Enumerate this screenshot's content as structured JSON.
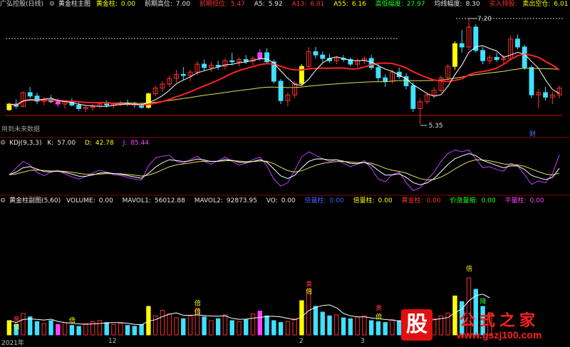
{
  "header_main": {
    "app": "广弘控股(日线)",
    "indicator": "黄金柱主图",
    "gold_col_label": "黄金柱:",
    "gold_col_value": "0.00",
    "prev_high_label": "前期高位:",
    "prev_high_value": "7.00",
    "prev_low_label": "前期低位:",
    "prev_low_value": "5.47",
    "a5_label": "A5:",
    "a5_value": "5.92",
    "a13_label": "A13:",
    "a13_value": "6.01",
    "a55_label": "A55:",
    "a55_value": "6.16",
    "hl_label": "高低幅度:",
    "hl_value": "27.97",
    "avg_label": "均线幅度:",
    "avg_value": "8.30",
    "buy_label": "买入持股:",
    "sell_label": "卖出空仓:",
    "sell_value": "6.01"
  },
  "main_annotations": {
    "high_marker": "7.20",
    "low_marker": "5.35",
    "cai_marker": "财",
    "future_note": "用到未来数据"
  },
  "header_kdj": {
    "name": "KDJ(9,3,3)",
    "k_label": "K:",
    "k_value": "57.00",
    "d_label": "D:",
    "d_value": "42.78",
    "j_label": "J:",
    "j_value": "85.44"
  },
  "header_sub": {
    "name": "黄金柱副图(5,60)",
    "volume_label": "VOLUME:",
    "volume_value": "0.00",
    "mavol1_label": "MAVOL1:",
    "mavol1_value": "56012.88",
    "mavol2_label": "MAVOL2:",
    "mavol2_value": "92873.95",
    "vo_label": "VO:",
    "vo_value": "0.00",
    "dibeizhu_label": "倍量柱:",
    "dibeizhu_value": "0.00",
    "beizhu_label": "倍量柱:",
    "beizhu_value": "0.00",
    "huangjin_label": "黄金柱:",
    "huangjin_value": "0.00",
    "jiasuo_label": "价涨量缩:",
    "jiasuo_value": "0.00",
    "pingliang_label": "平量柱:",
    "pingliang_value": "0.00"
  },
  "sub_annotations": {
    "bei": "倍",
    "huang": "黄",
    "jiang": "降",
    "ping": "平"
  },
  "x_axis": {
    "labels": [
      "2021年",
      "12",
      "2",
      "3"
    ]
  },
  "watermark": {
    "glyph": "股",
    "name": "公式之家",
    "url": "www.gszj100.com"
  },
  "colors": {
    "up": "#ff3030",
    "down": "#40e0ff",
    "gold": "#ffff00",
    "magenta": "#ff40ff",
    "ma5": "#ffffff",
    "ma13": "#ff2020",
    "ma55": "#e0e060"
  },
  "chart_data": {
    "type": "candlestick",
    "y_main_range": [
      5.2,
      7.35
    ],
    "candles": [
      [
        5.6,
        5.72,
        5.58,
        5.7
      ],
      [
        5.7,
        5.78,
        5.62,
        5.66
      ],
      [
        5.66,
        5.92,
        5.64,
        5.9
      ],
      [
        5.9,
        6.0,
        5.8,
        5.84
      ],
      [
        5.84,
        5.9,
        5.7,
        5.75
      ],
      [
        5.75,
        5.82,
        5.68,
        5.78
      ],
      [
        5.78,
        5.86,
        5.72,
        5.74
      ],
      [
        5.74,
        5.8,
        5.65,
        5.7
      ],
      [
        5.7,
        5.76,
        5.62,
        5.74
      ],
      [
        5.74,
        5.8,
        5.66,
        5.68
      ],
      [
        5.68,
        5.74,
        5.58,
        5.62
      ],
      [
        5.62,
        5.68,
        5.56,
        5.64
      ],
      [
        5.64,
        5.7,
        5.58,
        5.66
      ],
      [
        5.66,
        5.74,
        5.62,
        5.7
      ],
      [
        5.7,
        5.76,
        5.64,
        5.68
      ],
      [
        5.68,
        5.72,
        5.62,
        5.7
      ],
      [
        5.7,
        5.76,
        5.66,
        5.72
      ],
      [
        5.72,
        5.78,
        5.66,
        5.7
      ],
      [
        5.7,
        5.74,
        5.64,
        5.68
      ],
      [
        5.68,
        5.72,
        5.62,
        5.64
      ],
      [
        5.64,
        5.9,
        5.62,
        5.88
      ],
      [
        5.88,
        6.02,
        5.84,
        5.98
      ],
      [
        5.98,
        6.1,
        5.92,
        6.05
      ],
      [
        6.05,
        6.2,
        6.0,
        6.15
      ],
      [
        6.15,
        6.3,
        6.08,
        6.22
      ],
      [
        6.22,
        6.35,
        6.12,
        6.2
      ],
      [
        6.2,
        6.3,
        6.1,
        6.26
      ],
      [
        6.26,
        6.45,
        6.2,
        6.4
      ],
      [
        6.4,
        6.48,
        6.28,
        6.34
      ],
      [
        6.34,
        6.44,
        6.26,
        6.38
      ],
      [
        6.38,
        6.46,
        6.3,
        6.36
      ],
      [
        6.36,
        6.5,
        6.3,
        6.46
      ],
      [
        6.46,
        6.6,
        6.38,
        6.44
      ],
      [
        6.44,
        6.52,
        6.36,
        6.48
      ],
      [
        6.48,
        6.56,
        6.4,
        6.45
      ],
      [
        6.45,
        6.54,
        6.38,
        6.5
      ],
      [
        6.5,
        6.66,
        6.46,
        6.6
      ],
      [
        6.6,
        6.68,
        6.4,
        6.44
      ],
      [
        6.44,
        6.48,
        6.06,
        6.1
      ],
      [
        6.1,
        6.14,
        5.7,
        5.76
      ],
      [
        5.76,
        5.9,
        5.66,
        5.86
      ],
      [
        5.86,
        6.1,
        5.8,
        6.06
      ],
      [
        6.06,
        6.4,
        6.02,
        6.36
      ],
      [
        6.36,
        6.7,
        6.3,
        6.62
      ],
      [
        6.62,
        6.7,
        6.5,
        6.56
      ],
      [
        6.56,
        6.62,
        6.44,
        6.5
      ],
      [
        6.5,
        6.58,
        6.42,
        6.46
      ],
      [
        6.46,
        6.54,
        6.4,
        6.5
      ],
      [
        6.5,
        6.56,
        6.44,
        6.48
      ],
      [
        6.48,
        6.52,
        6.36,
        6.4
      ],
      [
        6.4,
        6.5,
        6.34,
        6.46
      ],
      [
        6.46,
        6.54,
        6.4,
        6.5
      ],
      [
        6.5,
        6.56,
        6.3,
        6.34
      ],
      [
        6.34,
        6.4,
        6.1,
        6.16
      ],
      [
        6.16,
        6.22,
        6.0,
        6.1
      ],
      [
        6.1,
        6.3,
        6.06,
        6.26
      ],
      [
        6.26,
        6.34,
        6.14,
        6.18
      ],
      [
        6.18,
        6.24,
        5.96,
        6.02
      ],
      [
        6.02,
        6.08,
        5.56,
        5.62
      ],
      [
        5.62,
        5.8,
        5.35,
        5.74
      ],
      [
        5.74,
        5.9,
        5.7,
        5.86
      ],
      [
        5.86,
        6.0,
        5.8,
        5.94
      ],
      [
        5.94,
        6.2,
        5.9,
        6.16
      ],
      [
        6.16,
        6.4,
        6.12,
        6.36
      ],
      [
        6.36,
        6.8,
        6.3,
        6.76
      ],
      [
        6.76,
        7.0,
        6.6,
        6.7
      ],
      [
        6.7,
        7.2,
        6.64,
        7.05
      ],
      [
        7.05,
        7.1,
        6.6,
        6.64
      ],
      [
        6.64,
        6.7,
        6.4,
        6.46
      ],
      [
        6.46,
        6.56,
        6.4,
        6.52
      ],
      [
        6.52,
        6.6,
        6.44,
        6.48
      ],
      [
        6.48,
        6.56,
        6.4,
        6.5
      ],
      [
        6.5,
        6.9,
        6.46,
        6.84
      ],
      [
        6.84,
        6.92,
        6.66,
        6.7
      ],
      [
        6.7,
        6.74,
        6.3,
        6.34
      ],
      [
        6.34,
        6.38,
        5.8,
        5.86
      ],
      [
        5.86,
        5.96,
        5.62,
        5.9
      ],
      [
        5.9,
        6.0,
        5.76,
        5.82
      ],
      [
        5.82,
        5.92,
        5.7,
        5.86
      ],
      [
        5.86,
        6.02,
        5.8,
        5.98
      ]
    ],
    "kdj_j": [
      40,
      55,
      70,
      62,
      45,
      38,
      46,
      50,
      42,
      35,
      30,
      36,
      44,
      50,
      46,
      40,
      38,
      34,
      30,
      28,
      60,
      78,
      82,
      84,
      70,
      66,
      74,
      82,
      70,
      64,
      72,
      80,
      70,
      62,
      66,
      74,
      80,
      60,
      30,
      14,
      22,
      50,
      80,
      92,
      84,
      76,
      70,
      74,
      66,
      58,
      64,
      72,
      54,
      30,
      24,
      40,
      46,
      22,
      4,
      10,
      28,
      46,
      70,
      88,
      96,
      92,
      96,
      76,
      56,
      58,
      52,
      48,
      66,
      60,
      40,
      18,
      26,
      22,
      42,
      85
    ],
    "volume": [
      30,
      22,
      45,
      38,
      28,
      24,
      30,
      22,
      26,
      20,
      18,
      24,
      28,
      30,
      26,
      22,
      24,
      20,
      18,
      22,
      60,
      40,
      52,
      44,
      36,
      34,
      40,
      56,
      38,
      30,
      34,
      42,
      30,
      28,
      32,
      44,
      50,
      40,
      30,
      26,
      28,
      34,
      72,
      96,
      60,
      48,
      40,
      42,
      36,
      34,
      38,
      40,
      30,
      28,
      26,
      32,
      30,
      28,
      36,
      30,
      32,
      34,
      40,
      46,
      82,
      70,
      120,
      96,
      60,
      44,
      40,
      38,
      50,
      42,
      36,
      44,
      40,
      32,
      30,
      36
    ]
  }
}
